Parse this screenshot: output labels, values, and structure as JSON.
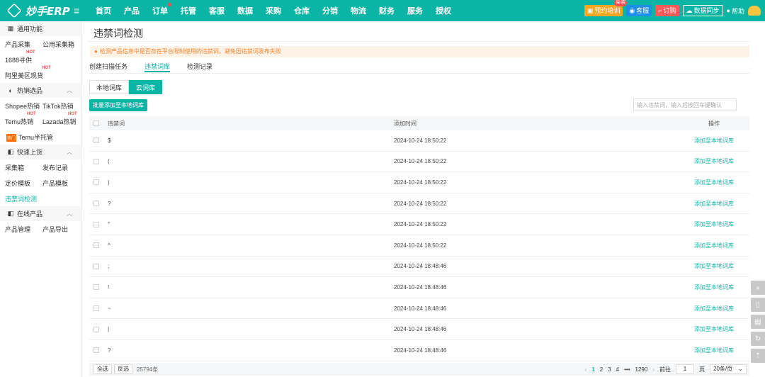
{
  "brand": {
    "name": "妙手ERP"
  },
  "nav": {
    "items": [
      "首页",
      "产品",
      "订单",
      "托管",
      "客服",
      "数据",
      "采购",
      "仓库",
      "分销",
      "物流",
      "财务",
      "服务",
      "授权"
    ]
  },
  "topright": {
    "train": "预约培训",
    "train_badge": "免费",
    "service": "客服",
    "order": "订购",
    "sync": "数据同步",
    "help": "帮助"
  },
  "sidebar": {
    "group1": "通用功能",
    "g1_links": [
      "产品采集",
      "公用采集箱",
      "1688寻供",
      "阿里美区现货"
    ],
    "hot": "HOT",
    "group2": "热销选品",
    "g2_links": [
      "Shopee热销",
      "TikTok热销",
      "Temu热销",
      "Lazada热销"
    ],
    "temu_tag": "热门",
    "temu_label": "Temu半托管",
    "group3": "快速上货",
    "g3_links": [
      "采集箱",
      "发布记录",
      "定价模板",
      "产品模板",
      "违禁词检测"
    ],
    "group4": "在线产品",
    "g4_links": [
      "产品管理",
      "产品导出"
    ]
  },
  "page": {
    "title": "违禁词检测",
    "notice": "检测产品信息中是否存在平台限制使用的违禁词，避免因违禁词发布失败",
    "tabs": [
      "创建扫描任务",
      "违禁词库",
      "检测记录"
    ],
    "seg": [
      "本地词库",
      "云词库"
    ],
    "batch_button": "批量添加至本地词库",
    "search_placeholder": "输入违禁词，输入后按回车键确认"
  },
  "table": {
    "headers": {
      "word": "违禁词",
      "time": "添加时间",
      "op": "操作"
    },
    "op_label": "添加至本地词库",
    "rows": [
      {
        "word": "$",
        "time": "2024-10-24 18:50:22"
      },
      {
        "word": "(",
        "time": "2024-10-24 18:50:22"
      },
      {
        "word": ")",
        "time": "2024-10-24 18:50:22"
      },
      {
        "word": "?",
        "time": "2024-10-24 18:50:22"
      },
      {
        "word": "°",
        "time": "2024-10-24 18:50:22"
      },
      {
        "word": "^",
        "time": "2024-10-24 18:50:22"
      },
      {
        "word": ";",
        "time": "2024-10-24 18:48:46"
      },
      {
        "word": "!",
        "time": "2024-10-24 18:48:46"
      },
      {
        "word": "~",
        "time": "2024-10-24 18:48:46"
      },
      {
        "word": "|",
        "time": "2024-10-24 18:48:46"
      },
      {
        "word": "?",
        "time": "2024-10-24 18:48:46"
      }
    ]
  },
  "footer": {
    "select_all": "全选",
    "invert": "反选",
    "count": "25794条",
    "pages": [
      "1",
      "2",
      "3",
      "4",
      "•••",
      "1290"
    ],
    "goto_label": "前往",
    "goto_value": "1",
    "page_unit": "页",
    "page_size": "20条/页"
  },
  "colors": {
    "accent": "#0bb5a5",
    "notice_bg": "#fdf2e6",
    "notice_text": "#f5842c"
  }
}
